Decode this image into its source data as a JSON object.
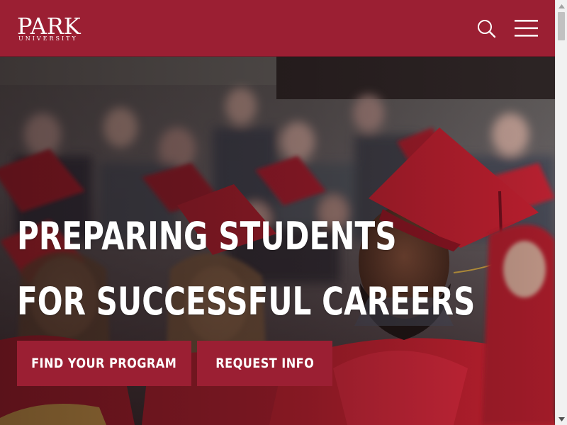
{
  "header": {
    "logo_main": "PARK",
    "logo_sub": "UNIVERSITY",
    "search_icon": "search-icon",
    "menu_icon": "hamburger-menu-icon",
    "background": "#9b1f33"
  },
  "hero": {
    "headline_line1": "PREPARING STUDENTS",
    "headline_line2": "FOR SUCCESSFUL CAREERS",
    "primary_cta": "FIND YOUR PROGRAM",
    "secondary_cta": "REQUEST INFO",
    "image": "graduates-in-red-caps-and-gowns-photo",
    "accent": "#9b1f33"
  },
  "scrollbar": {
    "up_icon": "scroll-up-arrow-icon",
    "down_icon": "scroll-down-arrow-icon"
  }
}
